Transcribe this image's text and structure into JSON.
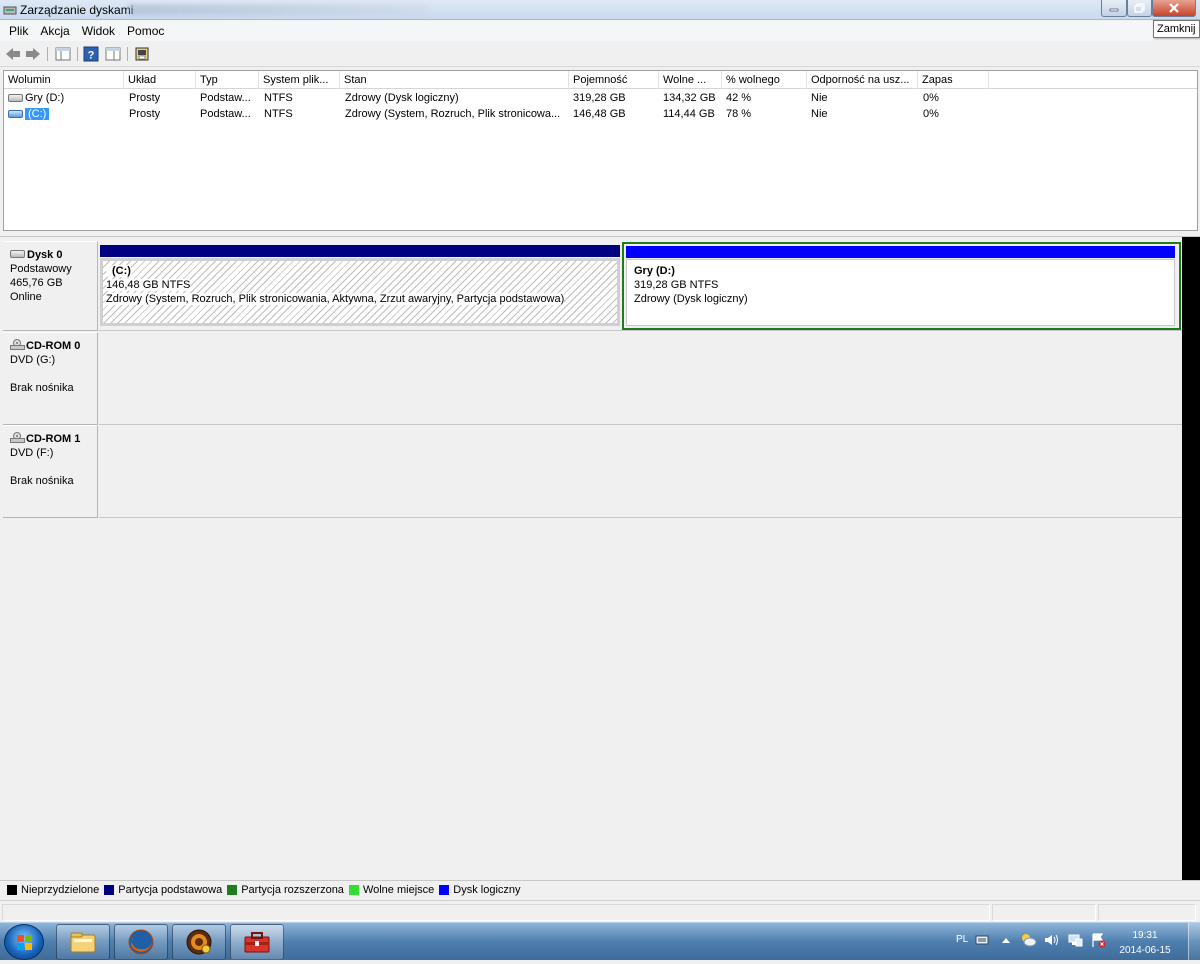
{
  "window": {
    "title": "Zarządzanie dyskami",
    "tooltip": "Zamknij"
  },
  "menu": [
    "Plik",
    "Akcja",
    "Widok",
    "Pomoc"
  ],
  "toolbar_icons": [
    "back-arrow-icon",
    "forward-arrow-icon",
    "console-tree-icon",
    "help-icon",
    "properties-icon",
    "disk-settings-icon"
  ],
  "volume_list": {
    "columns": [
      "Wolumin",
      "Układ",
      "Typ",
      "System plik...",
      "Stan",
      "Pojemność",
      "Wolne ...",
      "% wolnego",
      "Odporność na usz...",
      "Zapas"
    ],
    "rows": [
      {
        "volume": "Gry (D:)",
        "layout": "Prosty",
        "type": "Podstaw...",
        "fs": "NTFS",
        "status": "Zdrowy (Dysk logiczny)",
        "capacity": "319,28 GB",
        "free": "134,32 GB",
        "pct_free": "42 %",
        "fault": "Nie",
        "overhead": "0%"
      },
      {
        "volume": "(C:)",
        "layout": "Prosty",
        "type": "Podstaw...",
        "fs": "NTFS",
        "status": "Zdrowy (System, Rozruch, Plik stronicowa...",
        "capacity": "146,48 GB",
        "free": "114,44 GB",
        "pct_free": "78 %",
        "fault": "Nie",
        "overhead": "0%"
      }
    ]
  },
  "disks": {
    "disk0": {
      "name": "Dysk 0",
      "type": "Podstawowy",
      "size": "465,76 GB",
      "status": "Online",
      "partitions": {
        "c": {
          "label": "(C:)",
          "size_fs": "146,48 GB NTFS",
          "status": "Zdrowy (System, Rozruch, Plik stronicowania, Aktywna, Zrzut awaryjny, Partycja podstawowa)"
        },
        "d": {
          "label": "Gry  (D:)",
          "size_fs": "319,28 GB NTFS",
          "status": "Zdrowy (Dysk logiczny)"
        }
      }
    },
    "cdrom0": {
      "name": "CD-ROM 0",
      "drive": "DVD (G:)",
      "status": "Brak nośnika"
    },
    "cdrom1": {
      "name": "CD-ROM 1",
      "drive": "DVD (F:)",
      "status": "Brak nośnika"
    }
  },
  "legend": [
    {
      "label": "Nieprzydzielone",
      "color": "#000000"
    },
    {
      "label": "Partycja podstawowa",
      "color": "#000080"
    },
    {
      "label": "Partycja rozszerzona",
      "color": "#1e7b1e"
    },
    {
      "label": "Wolne miejsce",
      "color": "#33dd33"
    },
    {
      "label": "Dysk logiczny",
      "color": "#0000ff"
    }
  ],
  "taskbar": {
    "language": "PL",
    "time": "19:31",
    "date": "2014-06-15",
    "apps": [
      "file-explorer-icon",
      "firefox-icon",
      "game-client-icon",
      "toolbox-icon"
    ]
  }
}
